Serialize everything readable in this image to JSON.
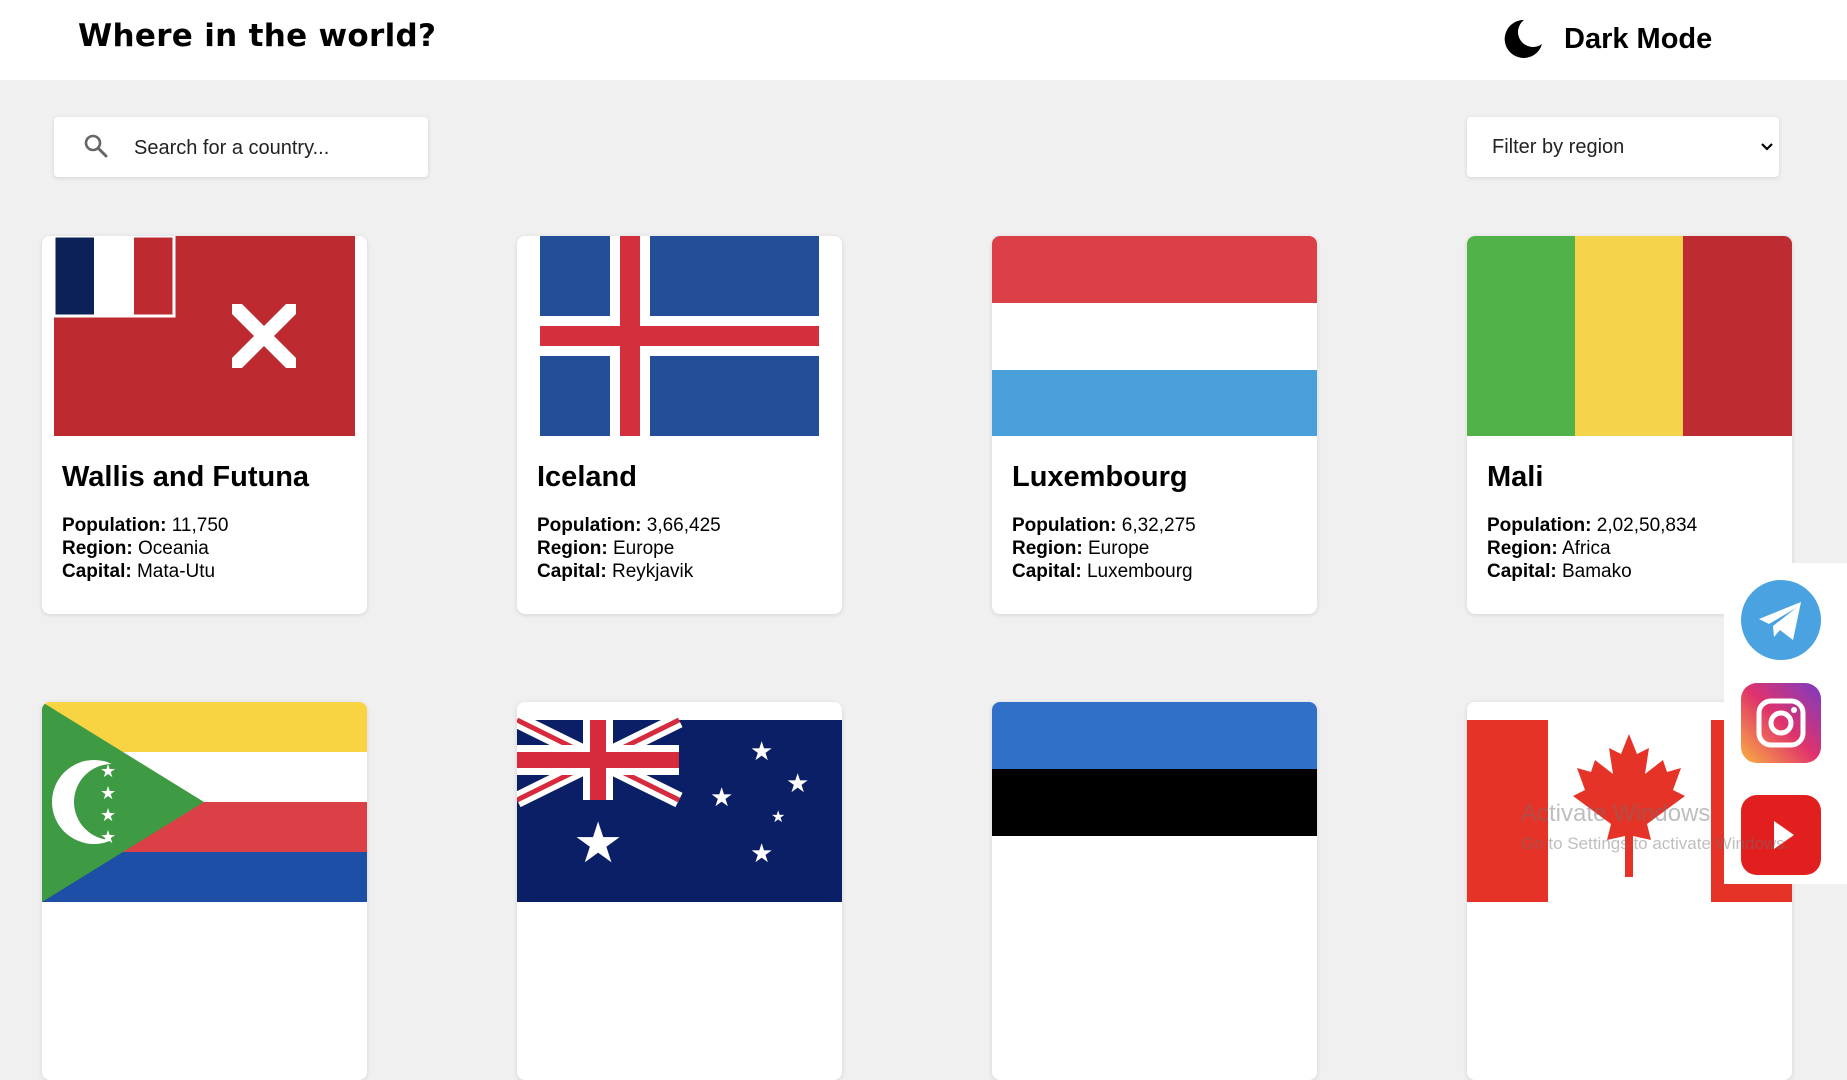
{
  "header": {
    "title": "Where in the world?",
    "dark_mode_label": "Dark Mode"
  },
  "search": {
    "placeholder": "Search for a country...",
    "value": ""
  },
  "filter": {
    "label": "Filter by region"
  },
  "labels": {
    "population": "Population:",
    "region": "Region:",
    "capital": "Capital:"
  },
  "countries": [
    {
      "name": "Wallis and Futuna",
      "population": "11,750",
      "region": "Oceania",
      "capital": "Mata-Utu"
    },
    {
      "name": "Iceland",
      "population": "3,66,425",
      "region": "Europe",
      "capital": "Reykjavik"
    },
    {
      "name": "Luxembourg",
      "population": "6,32,275",
      "region": "Europe",
      "capital": "Luxembourg"
    },
    {
      "name": "Mali",
      "population": "2,02,50,834",
      "region": "Africa",
      "capital": "Bamako"
    }
  ],
  "social_icons": [
    "telegram-icon",
    "instagram-icon",
    "youtube-icon"
  ],
  "watermark": {
    "line1": "Activate Windows",
    "line2": "Go to Settings to activate Windows."
  },
  "colors": {
    "background": "#f0f0f0",
    "card": "#ffffff",
    "text": "#000000"
  }
}
